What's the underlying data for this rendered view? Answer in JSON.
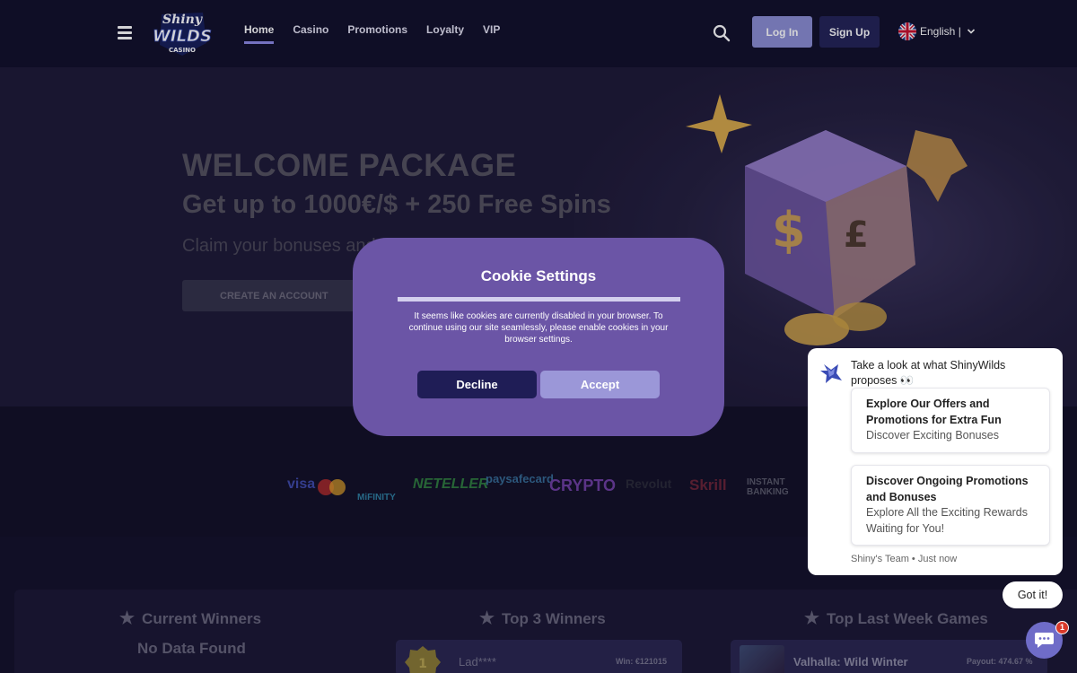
{
  "header": {
    "logo_text_top": "Shiny",
    "logo_text_main": "WILDS",
    "logo_text_bottom": "CASINO",
    "nav": [
      {
        "label": "Home",
        "active": true
      },
      {
        "label": "Casino"
      },
      {
        "label": "Promotions"
      },
      {
        "label": "Loyalty"
      },
      {
        "label": "VIP"
      }
    ],
    "login_label": "Log In",
    "signup_label": "Sign Up",
    "language_label": "English |"
  },
  "hero": {
    "title": "WELCOME PACKAGE",
    "subtitle": "Get up to 1000€/$ + 250 Free Spins",
    "claim_text": "Claim your bonuses and s",
    "cta_label": "CREATE AN ACCOUNT"
  },
  "payments": {
    "methods": [
      "visa",
      "mastercard",
      "MiFINITY",
      "NETELLER",
      "paysafecard",
      "CRYPTO",
      "Revolut",
      "Skrill",
      "INSTANT BANKING"
    ]
  },
  "winners": {
    "current_title": "Current Winners",
    "no_data": "No Data Found",
    "top3_title": "Top 3 Winners",
    "top3_entry": {
      "name": "Lad****",
      "win": "Win: €121015"
    },
    "top_games_title": "Top Last Week Games",
    "top_game": {
      "name": "Valhalla: Wild Winter",
      "payout": "Payout: 474.67 %"
    }
  },
  "cookie_modal": {
    "title": "Cookie Settings",
    "text": "It seems like cookies are currently disabled in your browser. To continue using our site seamlessly, please enable cookies in your browser settings.",
    "decline_label": "Decline",
    "accept_label": "Accept"
  },
  "chat": {
    "intro": "Take a look at what ShinyWilds proposes 👀",
    "options": [
      {
        "title": "Explore Our Offers and Promotions for Extra Fun",
        "subtitle": "Discover Exciting Bonuses"
      },
      {
        "title": "Discover Ongoing Promotions and Bonuses",
        "subtitle": "Explore All the Exciting Rewards Waiting for You!"
      }
    ],
    "meta": "Shiny's Team • Just now",
    "got_it_label": "Got it!",
    "unread_count": "1"
  },
  "colors": {
    "modal_bg": "#6b55a6",
    "accent": "#8b8ed3",
    "nav_underline": "#8e8ae6",
    "page_bg": "#14122a"
  }
}
